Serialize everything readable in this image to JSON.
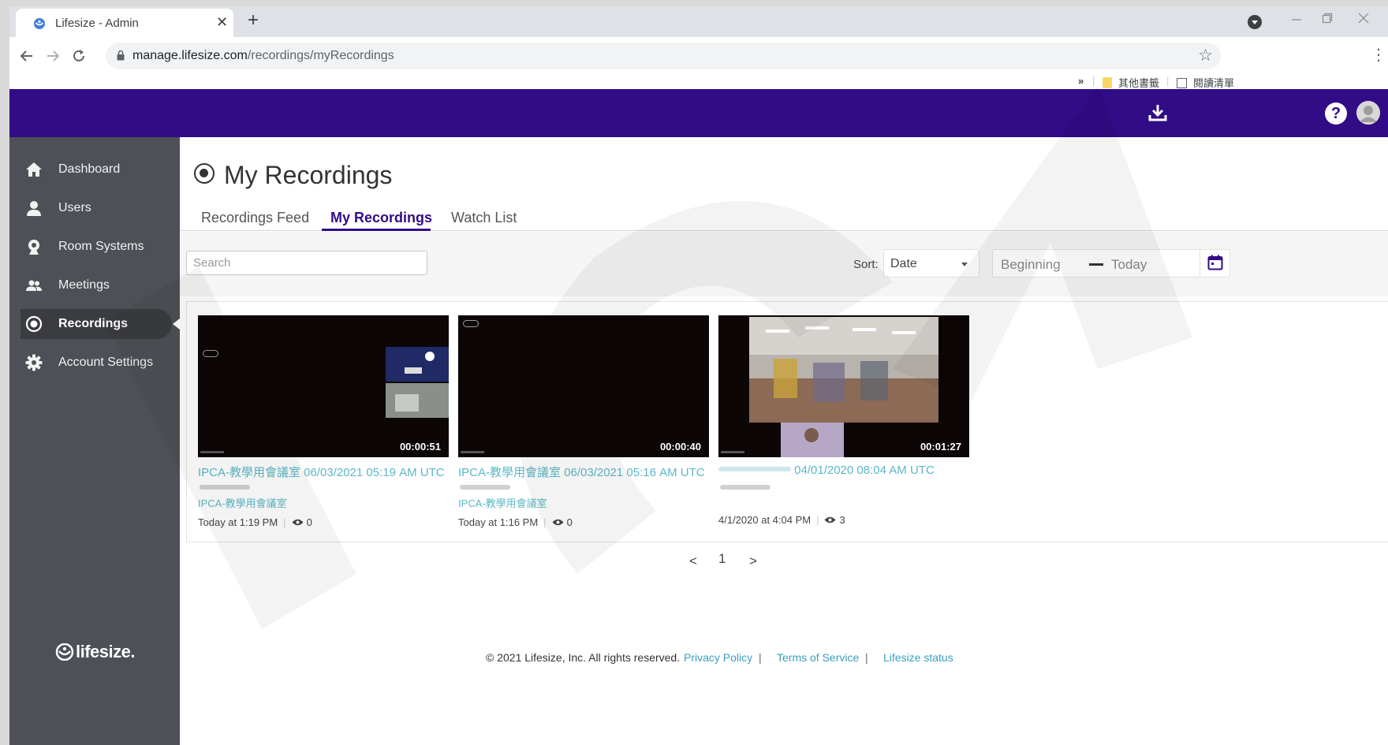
{
  "browser": {
    "tab_title": "Lifesize - Admin",
    "tab_close": "✕",
    "new_tab": "+",
    "url_domain": "manage.lifesize.com",
    "url_path": "/recordings/myRecordings",
    "bookmarks_overflow": "»",
    "bookmark_other": "其他書籤",
    "bookmark_reading_list": "閱讀清單"
  },
  "sidebar": {
    "items": [
      {
        "label": "Dashboard",
        "icon": "home-icon"
      },
      {
        "label": "Users",
        "icon": "user-icon"
      },
      {
        "label": "Room Systems",
        "icon": "webcam-icon"
      },
      {
        "label": "Meetings",
        "icon": "group-icon"
      },
      {
        "label": "Recordings",
        "icon": "record-icon",
        "active": true
      },
      {
        "label": "Account Settings",
        "icon": "gear-icon"
      }
    ],
    "logo_text": "lifesize."
  },
  "page": {
    "title": "My Recordings",
    "tabs": [
      "Recordings Feed",
      "My Recordings",
      "Watch List"
    ],
    "active_tab": "My Recordings"
  },
  "filters": {
    "search_placeholder": "Search",
    "sort_label": "Sort:",
    "sort_value": "Date",
    "date_from": "Beginning",
    "date_to": "Today"
  },
  "recordings": [
    {
      "title": "IPCA-教學用會議室 06/03/2021 05:19 AM UTC",
      "duration": "00:00:51",
      "room": "IPCA-教學用會議室",
      "date": "Today at 1:19 PM",
      "views": "0"
    },
    {
      "title": "IPCA-教學用會議室 06/03/2021 05:16 AM UTC",
      "duration": "00:00:40",
      "room": "IPCA-教學用會議室",
      "date": "Today at 1:16 PM",
      "views": "0"
    },
    {
      "title": "04/01/2020 08:04 AM UTC",
      "duration": "00:01:27",
      "room": "",
      "date": "4/1/2020 at 4:04 PM",
      "views": "3"
    }
  ],
  "pagination": {
    "prev": "<",
    "current": "1",
    "next": ">"
  },
  "footer": {
    "copyright": "© 2021 Lifesize, Inc. All rights reserved.",
    "privacy": "Privacy Policy",
    "terms": "Terms of Service",
    "status": "Lifesize status",
    "separator": "|"
  },
  "colors": {
    "header": "#320b86",
    "sidebar": "#4d5056",
    "link": "#5cb8c6",
    "accent": "#320b86"
  }
}
